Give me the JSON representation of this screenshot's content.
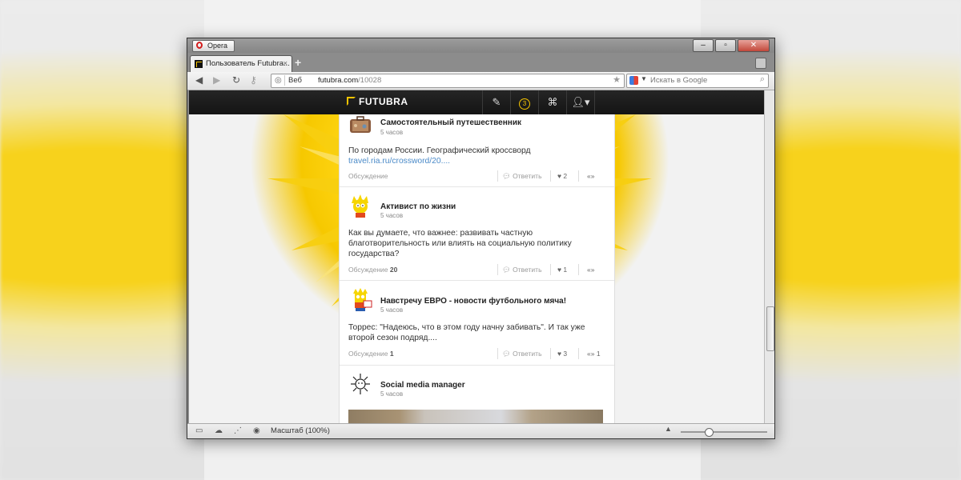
{
  "browser": {
    "menu_label": "Opera",
    "tab_title": "Пользователь Futubra...",
    "tab_close": "×",
    "new_tab": "+",
    "address_mode": "Веб",
    "url_host": "futubra.com",
    "url_path": "/10028",
    "search_placeholder": "Искать в Google",
    "zoom_label": "Масштаб (100%)"
  },
  "site": {
    "logo": "FUTUBRA",
    "notification_count": "3",
    "accent": "#f6c400"
  },
  "posts": [
    {
      "author": "Самостоятельный путешественник",
      "time": "5 часов",
      "text": "По городам России. Географический кроссворд",
      "link": "travel.ria.ru/crossword/20....",
      "discussion_label": "Обсуждение",
      "discussion_count": "",
      "reply_label": "Ответить",
      "likes": "2",
      "reposts": ""
    },
    {
      "author": "Активист по жизни",
      "time": "5 часов",
      "text": "Как вы думаете, что важнее: развивать частную благотворительность или влиять на социальную политику государства?",
      "discussion_label": "Обсуждение",
      "discussion_count": "20",
      "reply_label": "Ответить",
      "likes": "1",
      "reposts": ""
    },
    {
      "author": "Навстречу ЕВРО - новости футбольного мяча!",
      "time": "5 часов",
      "text": "Торрес: \"Надеюсь, что в этом году начну забивать\". И так уже второй сезон подряд....",
      "discussion_label": "Обсуждение",
      "discussion_count": "1",
      "reply_label": "Ответить",
      "likes": "3",
      "reposts": "1"
    },
    {
      "author": "Social media manager",
      "time": "5 часов"
    }
  ]
}
